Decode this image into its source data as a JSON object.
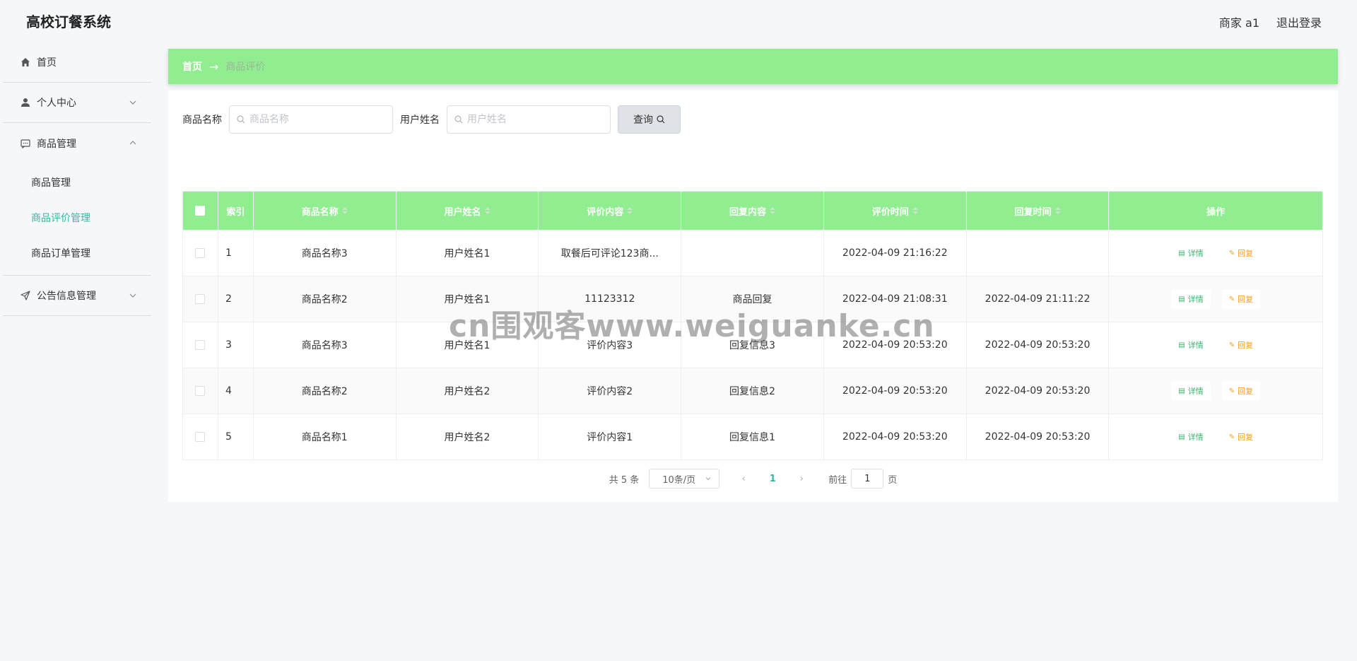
{
  "header": {
    "title": "高校订餐系统",
    "user": "商家 a1",
    "logout": "退出登录"
  },
  "sidebar": {
    "items": [
      {
        "label": "首页",
        "icon": "home-icon"
      },
      {
        "label": "个人中心",
        "icon": "user-icon"
      },
      {
        "label": "商品管理",
        "icon": "chat-icon"
      },
      {
        "label": "公告信息管理",
        "icon": "send-icon"
      }
    ],
    "sub": [
      {
        "label": "商品管理"
      },
      {
        "label": "商品评价管理"
      },
      {
        "label": "商品订单管理"
      }
    ]
  },
  "breadcrumb": {
    "home": "首页",
    "current": "商品评价"
  },
  "search": {
    "name_label": "商品名称",
    "name_placeholder": "商品名称",
    "user_label": "用户姓名",
    "user_placeholder": "用户姓名",
    "query_label": "查询"
  },
  "table": {
    "headers": [
      "索引",
      "商品名称",
      "用户姓名",
      "评价内容",
      "回复内容",
      "评价时间",
      "回复时间",
      "操作"
    ],
    "rows": [
      {
        "idx": "1",
        "name": "商品名称3",
        "user": "用户姓名1",
        "content": "取餐后可评论123商...",
        "reply": "",
        "time": "2022-04-09 21:16:22",
        "reply_time": ""
      },
      {
        "idx": "2",
        "name": "商品名称2",
        "user": "用户姓名1",
        "content": "11123312",
        "reply": "商品回复",
        "time": "2022-04-09 21:08:31",
        "reply_time": "2022-04-09 21:11:22"
      },
      {
        "idx": "3",
        "name": "商品名称3",
        "user": "用户姓名1",
        "content": "评价内容3",
        "reply": "回复信息3",
        "time": "2022-04-09 20:53:20",
        "reply_time": "2022-04-09 20:53:20"
      },
      {
        "idx": "4",
        "name": "商品名称2",
        "user": "用户姓名2",
        "content": "评价内容2",
        "reply": "回复信息2",
        "time": "2022-04-09 20:53:20",
        "reply_time": "2022-04-09 20:53:20"
      },
      {
        "idx": "5",
        "name": "商品名称1",
        "user": "用户姓名2",
        "content": "评价内容1",
        "reply": "回复信息1",
        "time": "2022-04-09 20:53:20",
        "reply_time": "2022-04-09 20:53:20"
      }
    ],
    "detail_label": "详情",
    "reply_label": "回复"
  },
  "pager": {
    "total": "共 5 条",
    "size": "10条/页",
    "page": "1",
    "goto_label": "前往",
    "goto_value": "1",
    "page_suffix": "页"
  },
  "watermark": "cn围观客www.weiguanke.cn",
  "colors": {
    "accent": "#90ee90",
    "active": "#3cb3a2",
    "detail": "#3cb371",
    "reply": "#f0a020"
  }
}
